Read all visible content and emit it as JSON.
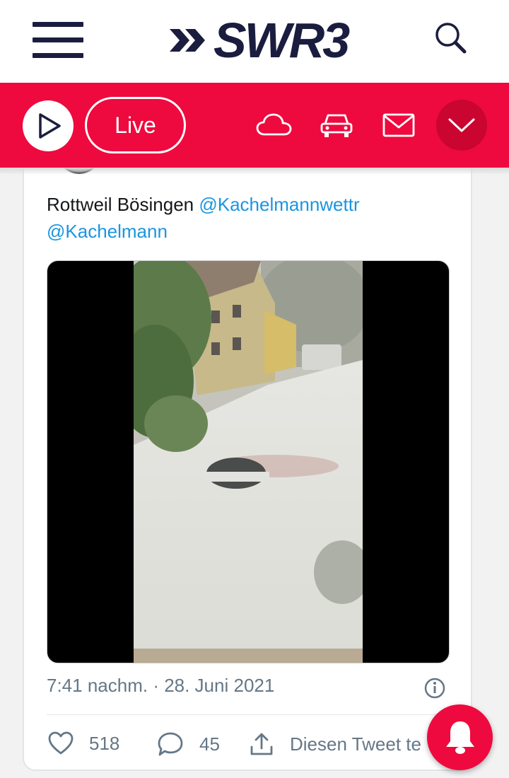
{
  "header": {
    "logo_text": "SWR3",
    "icons": {
      "menu": "hamburger-menu-icon",
      "search": "search-icon"
    }
  },
  "player_bar": {
    "live_label": "Live",
    "icons": [
      "play-icon",
      "cloud-icon",
      "car-icon",
      "mail-icon",
      "chevron-down-icon"
    ]
  },
  "tweet": {
    "text_prefix": "Rottweil Bösingen ",
    "mention_1": "@Kachelmannwettr",
    "mention_2": "@Kachelmann",
    "timestamp": "7:41 nachm. · 28. Juni 2021",
    "likes": "518",
    "replies": "45",
    "share_label": "Diesen Tweet te"
  },
  "colors": {
    "brand_red": "#ee0a3e",
    "navy": "#1b1d3f",
    "link_blue": "#1b95e0",
    "muted_gray": "#657786"
  }
}
